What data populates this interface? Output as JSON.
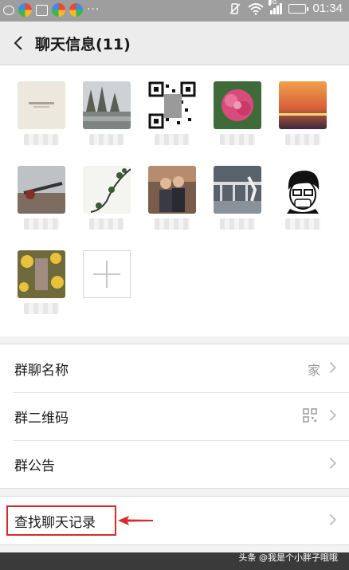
{
  "status_bar": {
    "time": "01:34",
    "network": "3G"
  },
  "header": {
    "title": "聊天信息(11)"
  },
  "members": [
    {
      "avatar": "card-avatar"
    },
    {
      "avatar": "lake-trees-avatar"
    },
    {
      "avatar": "qr-pattern-avatar"
    },
    {
      "avatar": "pink-flower-avatar"
    },
    {
      "avatar": "sunset-avatar"
    },
    {
      "avatar": "telescope-avatar"
    },
    {
      "avatar": "branch-avatar"
    },
    {
      "avatar": "couple-avatar"
    },
    {
      "avatar": "railing-avatar"
    },
    {
      "avatar": "cartoon-face-avatar"
    },
    {
      "avatar": "sunflower-avatar"
    }
  ],
  "settings": {
    "group_name_label": "群聊名称",
    "group_name_value": "家",
    "group_qr_label": "群二维码",
    "group_notice_label": "群公告",
    "search_history_label": "查找聊天记录"
  },
  "watermark": "头条 @我是个小胖子哦哦",
  "colors": {
    "highlight": "#d82a2a",
    "background": "#f2f2f2"
  }
}
